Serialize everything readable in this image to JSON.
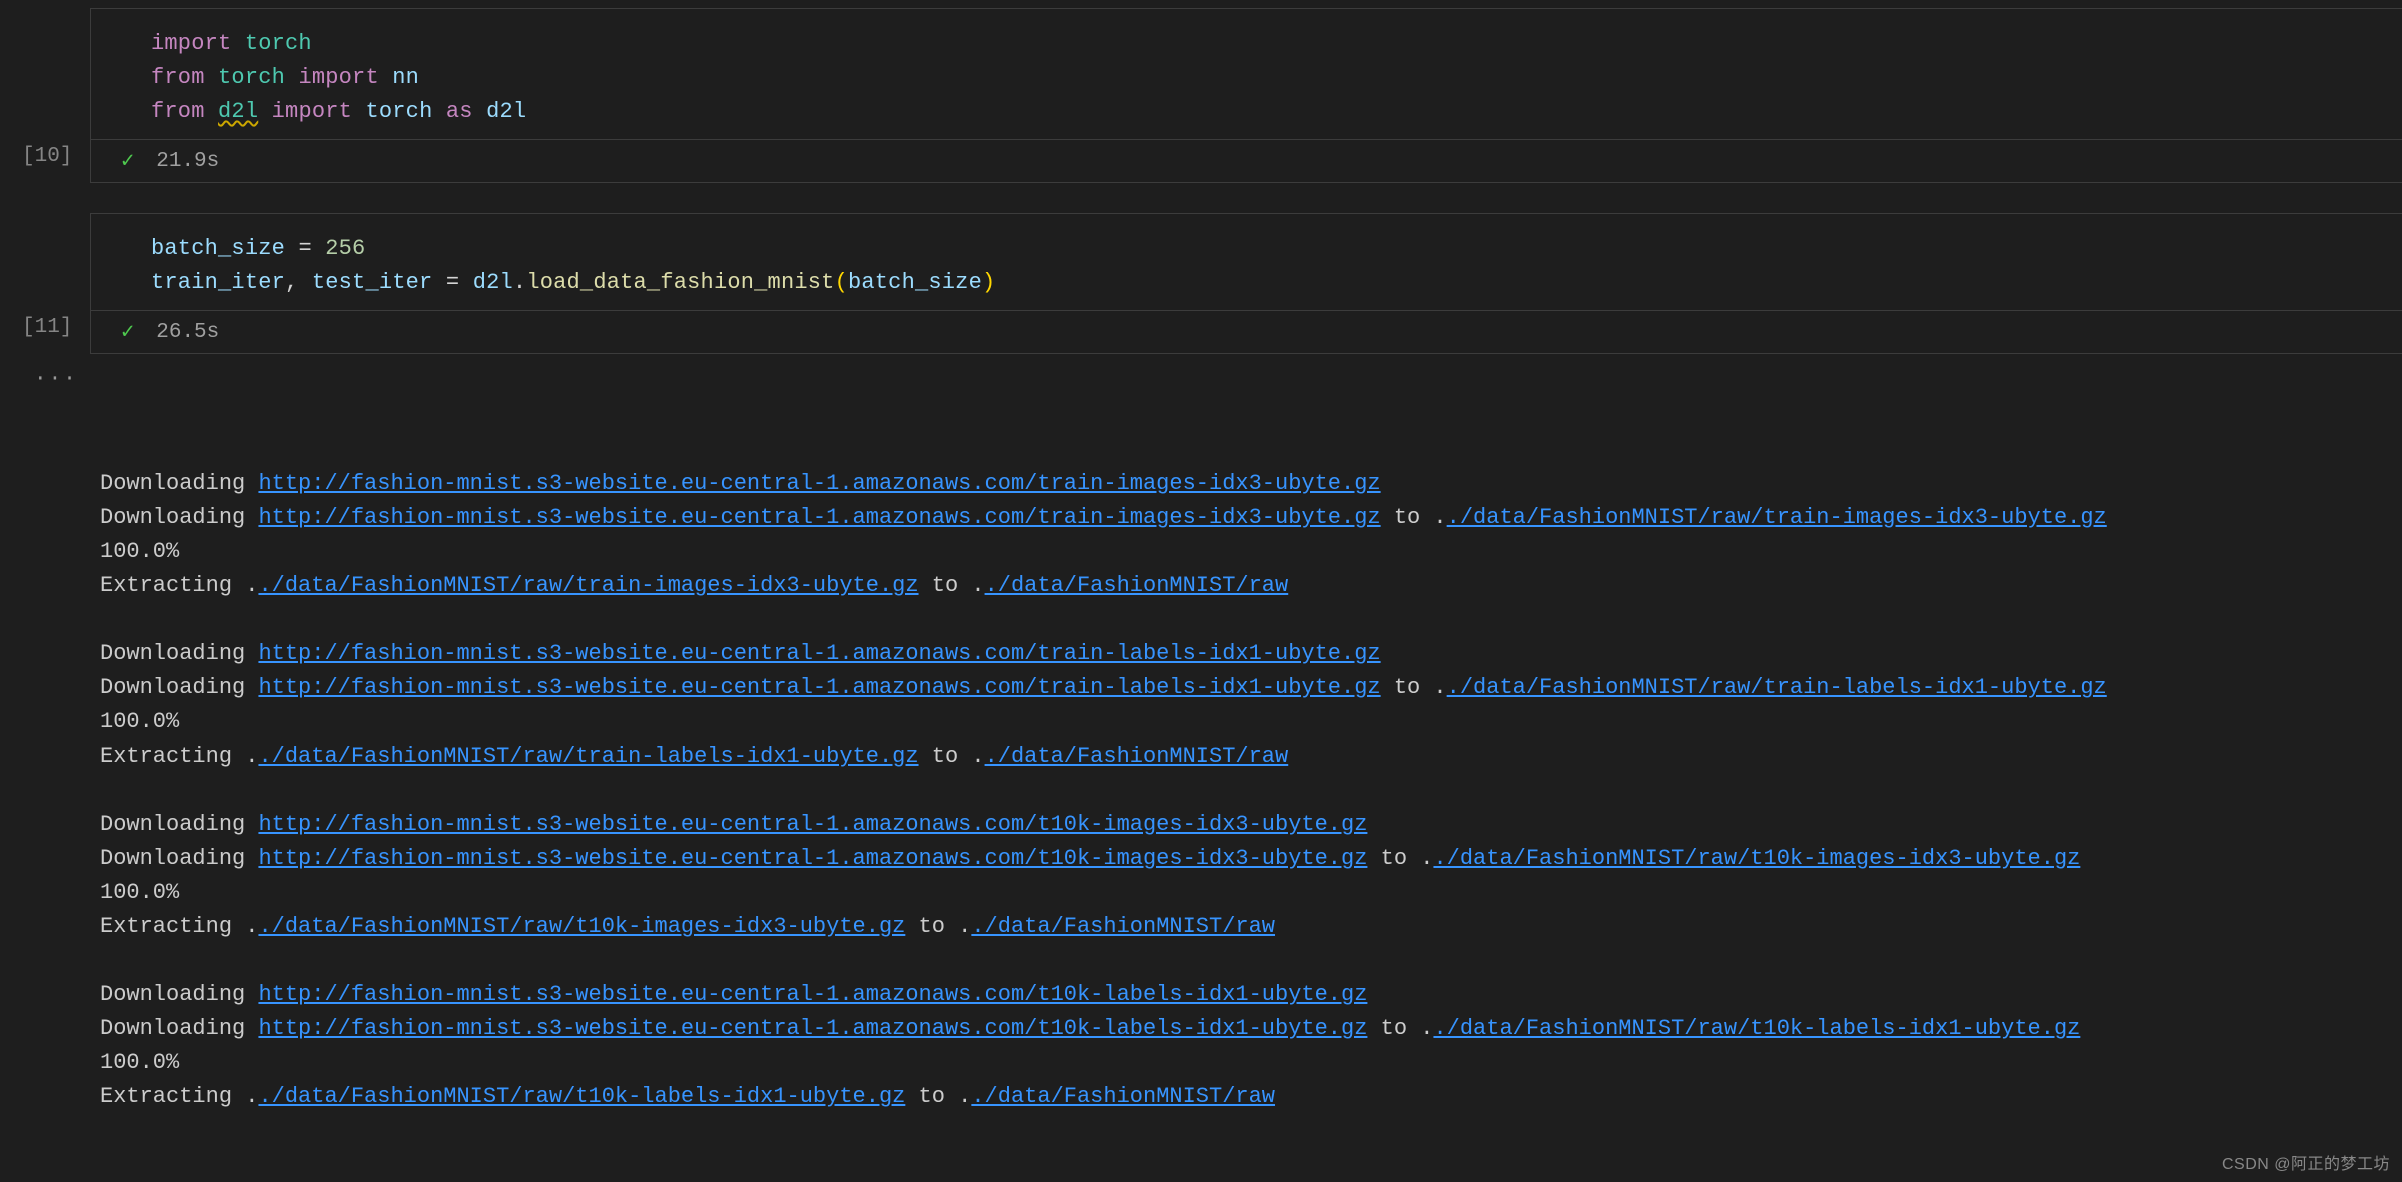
{
  "cells": [
    {
      "exec_count": "[10]",
      "status_time": "21.9s",
      "code_tokens": [
        [
          {
            "t": "import",
            "c": "kw"
          },
          {
            "t": " ",
            "c": "pl"
          },
          {
            "t": "torch",
            "c": "mod"
          }
        ],
        [
          {
            "t": "from",
            "c": "kw"
          },
          {
            "t": " ",
            "c": "pl"
          },
          {
            "t": "torch",
            "c": "mod"
          },
          {
            "t": " ",
            "c": "pl"
          },
          {
            "t": "import",
            "c": "kw"
          },
          {
            "t": " ",
            "c": "pl"
          },
          {
            "t": "nn",
            "c": "var"
          }
        ],
        [
          {
            "t": "from",
            "c": "kw"
          },
          {
            "t": " ",
            "c": "pl"
          },
          {
            "t": "d2l",
            "c": "mod squiggle"
          },
          {
            "t": " ",
            "c": "pl"
          },
          {
            "t": "import",
            "c": "kw"
          },
          {
            "t": " ",
            "c": "pl"
          },
          {
            "t": "torch",
            "c": "var"
          },
          {
            "t": " ",
            "c": "pl"
          },
          {
            "t": "as",
            "c": "kw"
          },
          {
            "t": " ",
            "c": "pl"
          },
          {
            "t": "d2l",
            "c": "var"
          }
        ]
      ]
    },
    {
      "exec_count": "[11]",
      "status_time": "26.5s",
      "code_tokens": [
        [
          {
            "t": "batch_size",
            "c": "var"
          },
          {
            "t": " ",
            "c": "pl"
          },
          {
            "t": "=",
            "c": "op"
          },
          {
            "t": " ",
            "c": "pl"
          },
          {
            "t": "256",
            "c": "num"
          }
        ],
        [
          {
            "t": "train_iter",
            "c": "var"
          },
          {
            "t": ",",
            "c": "pl"
          },
          {
            "t": " ",
            "c": "pl"
          },
          {
            "t": "test_iter",
            "c": "var"
          },
          {
            "t": " ",
            "c": "pl"
          },
          {
            "t": "=",
            "c": "op"
          },
          {
            "t": " ",
            "c": "pl"
          },
          {
            "t": "d2l",
            "c": "var"
          },
          {
            "t": ".",
            "c": "pl"
          },
          {
            "t": "load_data_fashion_mnist",
            "c": "fn"
          },
          {
            "t": "(",
            "c": "paren-y"
          },
          {
            "t": "batch_size",
            "c": "var"
          },
          {
            "t": ")",
            "c": "paren-y"
          }
        ]
      ],
      "output_lines": [
        [
          {
            "t": "Downloading "
          },
          {
            "l": "http://fashion-mnist.s3-website.eu-central-1.amazonaws.com/train-images-idx3-ubyte.gz"
          }
        ],
        [
          {
            "t": "Downloading "
          },
          {
            "l": "http://fashion-mnist.s3-website.eu-central-1.amazonaws.com/train-images-idx3-ubyte.gz"
          },
          {
            "t": " to ."
          },
          {
            "l": "./data/FashionMNIST/raw/train-images-idx3-ubyte.gz"
          }
        ],
        [
          {
            "t": "100.0%"
          }
        ],
        [
          {
            "t": "Extracting ."
          },
          {
            "l": "./data/FashionMNIST/raw/train-images-idx3-ubyte.gz"
          },
          {
            "t": " to ."
          },
          {
            "l": "./data/FashionMNIST/raw"
          }
        ],
        [
          {
            "t": " "
          }
        ],
        [
          {
            "t": "Downloading "
          },
          {
            "l": "http://fashion-mnist.s3-website.eu-central-1.amazonaws.com/train-labels-idx1-ubyte.gz"
          }
        ],
        [
          {
            "t": "Downloading "
          },
          {
            "l": "http://fashion-mnist.s3-website.eu-central-1.amazonaws.com/train-labels-idx1-ubyte.gz"
          },
          {
            "t": " to ."
          },
          {
            "l": "./data/FashionMNIST/raw/train-labels-idx1-ubyte.gz"
          }
        ],
        [
          {
            "t": "100.0%"
          }
        ],
        [
          {
            "t": "Extracting ."
          },
          {
            "l": "./data/FashionMNIST/raw/train-labels-idx1-ubyte.gz"
          },
          {
            "t": " to ."
          },
          {
            "l": "./data/FashionMNIST/raw"
          }
        ],
        [
          {
            "t": " "
          }
        ],
        [
          {
            "t": "Downloading "
          },
          {
            "l": "http://fashion-mnist.s3-website.eu-central-1.amazonaws.com/t10k-images-idx3-ubyte.gz"
          }
        ],
        [
          {
            "t": "Downloading "
          },
          {
            "l": "http://fashion-mnist.s3-website.eu-central-1.amazonaws.com/t10k-images-idx3-ubyte.gz"
          },
          {
            "t": " to ."
          },
          {
            "l": "./data/FashionMNIST/raw/t10k-images-idx3-ubyte.gz"
          }
        ],
        [
          {
            "t": "100.0%"
          }
        ],
        [
          {
            "t": "Extracting ."
          },
          {
            "l": "./data/FashionMNIST/raw/t10k-images-idx3-ubyte.gz"
          },
          {
            "t": " to ."
          },
          {
            "l": "./data/FashionMNIST/raw"
          }
        ],
        [
          {
            "t": " "
          }
        ],
        [
          {
            "t": "Downloading "
          },
          {
            "l": "http://fashion-mnist.s3-website.eu-central-1.amazonaws.com/t10k-labels-idx1-ubyte.gz"
          }
        ],
        [
          {
            "t": "Downloading "
          },
          {
            "l": "http://fashion-mnist.s3-website.eu-central-1.amazonaws.com/t10k-labels-idx1-ubyte.gz"
          },
          {
            "t": " to ."
          },
          {
            "l": "./data/FashionMNIST/raw/t10k-labels-idx1-ubyte.gz"
          }
        ],
        [
          {
            "t": "100.0%"
          }
        ],
        [
          {
            "t": "Extracting ."
          },
          {
            "l": "./data/FashionMNIST/raw/t10k-labels-idx1-ubyte.gz"
          },
          {
            "t": " to ."
          },
          {
            "l": "./data/FashionMNIST/raw"
          }
        ]
      ]
    }
  ],
  "ellipsis": "···",
  "watermark": "CSDN @阿正的梦工坊"
}
